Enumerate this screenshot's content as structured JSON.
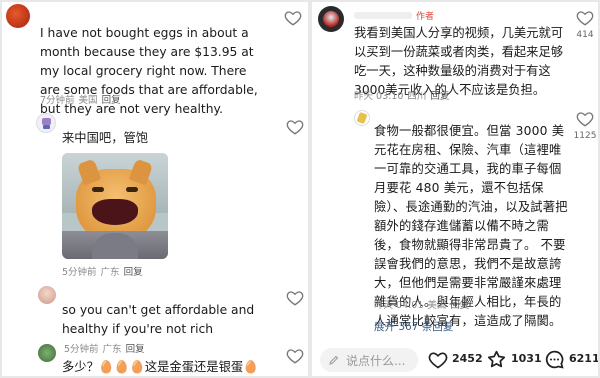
{
  "left": {
    "comments": [
      {
        "text": "I have not bought eggs in about a month because they are $13.95 at my local grocery right now. There are some foods that are affordable, but they are not very healthy.",
        "time": "7分钟前",
        "location": "美国",
        "reply": "回复"
      },
      {
        "text": "来中国吧，管饱",
        "time": "5分钟前",
        "location": "广东",
        "reply": "回复"
      },
      {
        "text": "so you can't get affordable and healthy if you're not rich",
        "time": "5分钟前",
        "location": "广东",
        "reply": "回复"
      },
      {
        "text": "多少？🥚🥚🥚这是金蛋还是银蛋🥚"
      }
    ]
  },
  "right": {
    "comments": [
      {
        "badge": "作者",
        "text": "我看到美国人分享的视频，几美元就可以买到一份蔬菜或者肉类，看起来足够吃一天，这种数量级的消费对于有这3000美元收入的人不应该是负担。",
        "time": "昨天 03:10",
        "location": "四川",
        "reply": "回复",
        "likes": "414"
      },
      {
        "text": "食物一般都很便宜。但當 3000 美元花在房租、保險、汽車（這裡唯一可靠的交通工具，我的車子每個月要花 480 美元，還不包括保險）、長途通勤的汽油，以及試著把額外的錢存進儲蓄以備不時之需後，食物就顯得非常昂貴了。 不要誤會我們的意思，我們不是故意誇大，但他們是需要非常嚴謹來處理雜貨的人。與年輕人相比，年長的人通常比較富有，這造成了隔閡。",
        "time": "昨天 04:01",
        "location": "美国",
        "reply": "回复",
        "likes": "1125"
      }
    ],
    "expand_label": "展开 367 条回复",
    "bottom_bar": {
      "input_placeholder": "说点什么...",
      "likes": "2452",
      "favorites": "1031",
      "comments": "6211"
    }
  },
  "colors": {
    "author_badge": "#e0443c",
    "expand_link": "#3b5b85"
  },
  "icons": [
    "heart-icon",
    "star-icon",
    "comment-icon",
    "pencil-icon",
    "egg-emoji"
  ]
}
